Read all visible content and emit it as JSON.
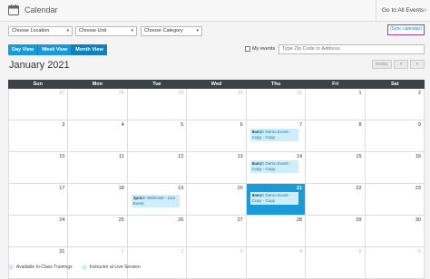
{
  "header": {
    "title": "Calendar",
    "goto_label": "Go to All Events",
    "sync_label": "(Sync calendar)"
  },
  "filters": {
    "location": "Choose Location",
    "unit": "Choose Unit",
    "category": "Choose Category"
  },
  "views": {
    "day": "Day View",
    "week": "Week View",
    "month": "Month View",
    "active": "month"
  },
  "my_events_label": "My events",
  "zip_placeholder": "Type Zip Code or Address",
  "month_title": "January 2021",
  "today_label": "today",
  "nav": {
    "prev": "‹",
    "next": "›"
  },
  "days_of_week": [
    "Sun",
    "Mon",
    "Tue",
    "Wed",
    "Thu",
    "Fri",
    "Sat"
  ],
  "weeks": [
    [
      "27",
      "28",
      "29",
      "30",
      "31",
      "1",
      "2"
    ],
    [
      "3",
      "4",
      "5",
      "6",
      "7",
      "8",
      "9"
    ],
    [
      "10",
      "11",
      "12",
      "13",
      "14",
      "15",
      "16"
    ],
    [
      "17",
      "18",
      "19",
      "20",
      "21",
      "22",
      "23"
    ],
    [
      "24",
      "25",
      "26",
      "27",
      "28",
      "29",
      "30"
    ],
    [
      "31",
      "1",
      "2",
      "3",
      "4",
      "5",
      "6"
    ]
  ],
  "events": [
    {
      "time": "8am",
      "title": "|E Demo Event - Copy - Copy"
    },
    {
      "time": "8am",
      "title": "|E Demo Event - Copy - Copy"
    },
    {
      "time": "3pm",
      "title": "|E WebCast - Live Event"
    },
    {
      "time": "8am",
      "title": "|E Demo Event - Copy - Copy"
    }
  ],
  "legend": [
    {
      "label": "Available In-Class Trainings",
      "color": "#cdeefa"
    },
    {
      "label": "Instructor at Live Session",
      "color": "#cdeefa"
    }
  ],
  "colors": {
    "accent": "#179ad7",
    "header_row": "#3b4349",
    "event_bg": "#cdeefa",
    "sync_border": "#a33a9c"
  }
}
